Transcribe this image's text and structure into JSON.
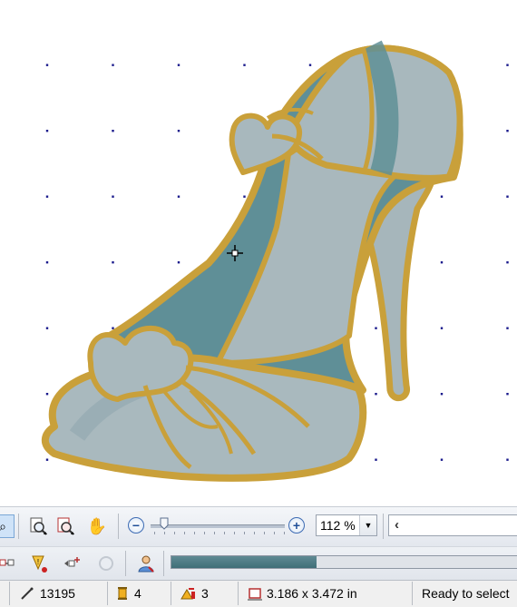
{
  "canvas": {
    "grid_color": "#1a1a8c",
    "colors": {
      "outline": "#c9a03a",
      "fill_light": "#aebdc2",
      "fill_teal": "#5f8f97",
      "fill_mid": "#94a9b0"
    }
  },
  "toolbar": {
    "buttons": [
      "select-tool",
      "zoom-window",
      "zoom-page",
      "pan-hand"
    ],
    "zoom_value": "112 %",
    "zoom_dropdown_icon": "chevron-down-icon",
    "scroll_left_icon": "‹"
  },
  "toolbar2": {
    "buttons": [
      "node-edit",
      "stitch-warning",
      "move-nodes",
      "refresh",
      "user-info"
    ],
    "progress": 0.42
  },
  "status": {
    "stitch_count": "13195",
    "color_count": "4",
    "trim_count": "3",
    "dimensions": "3.186 x 3.472 in",
    "message": "Ready to select"
  }
}
